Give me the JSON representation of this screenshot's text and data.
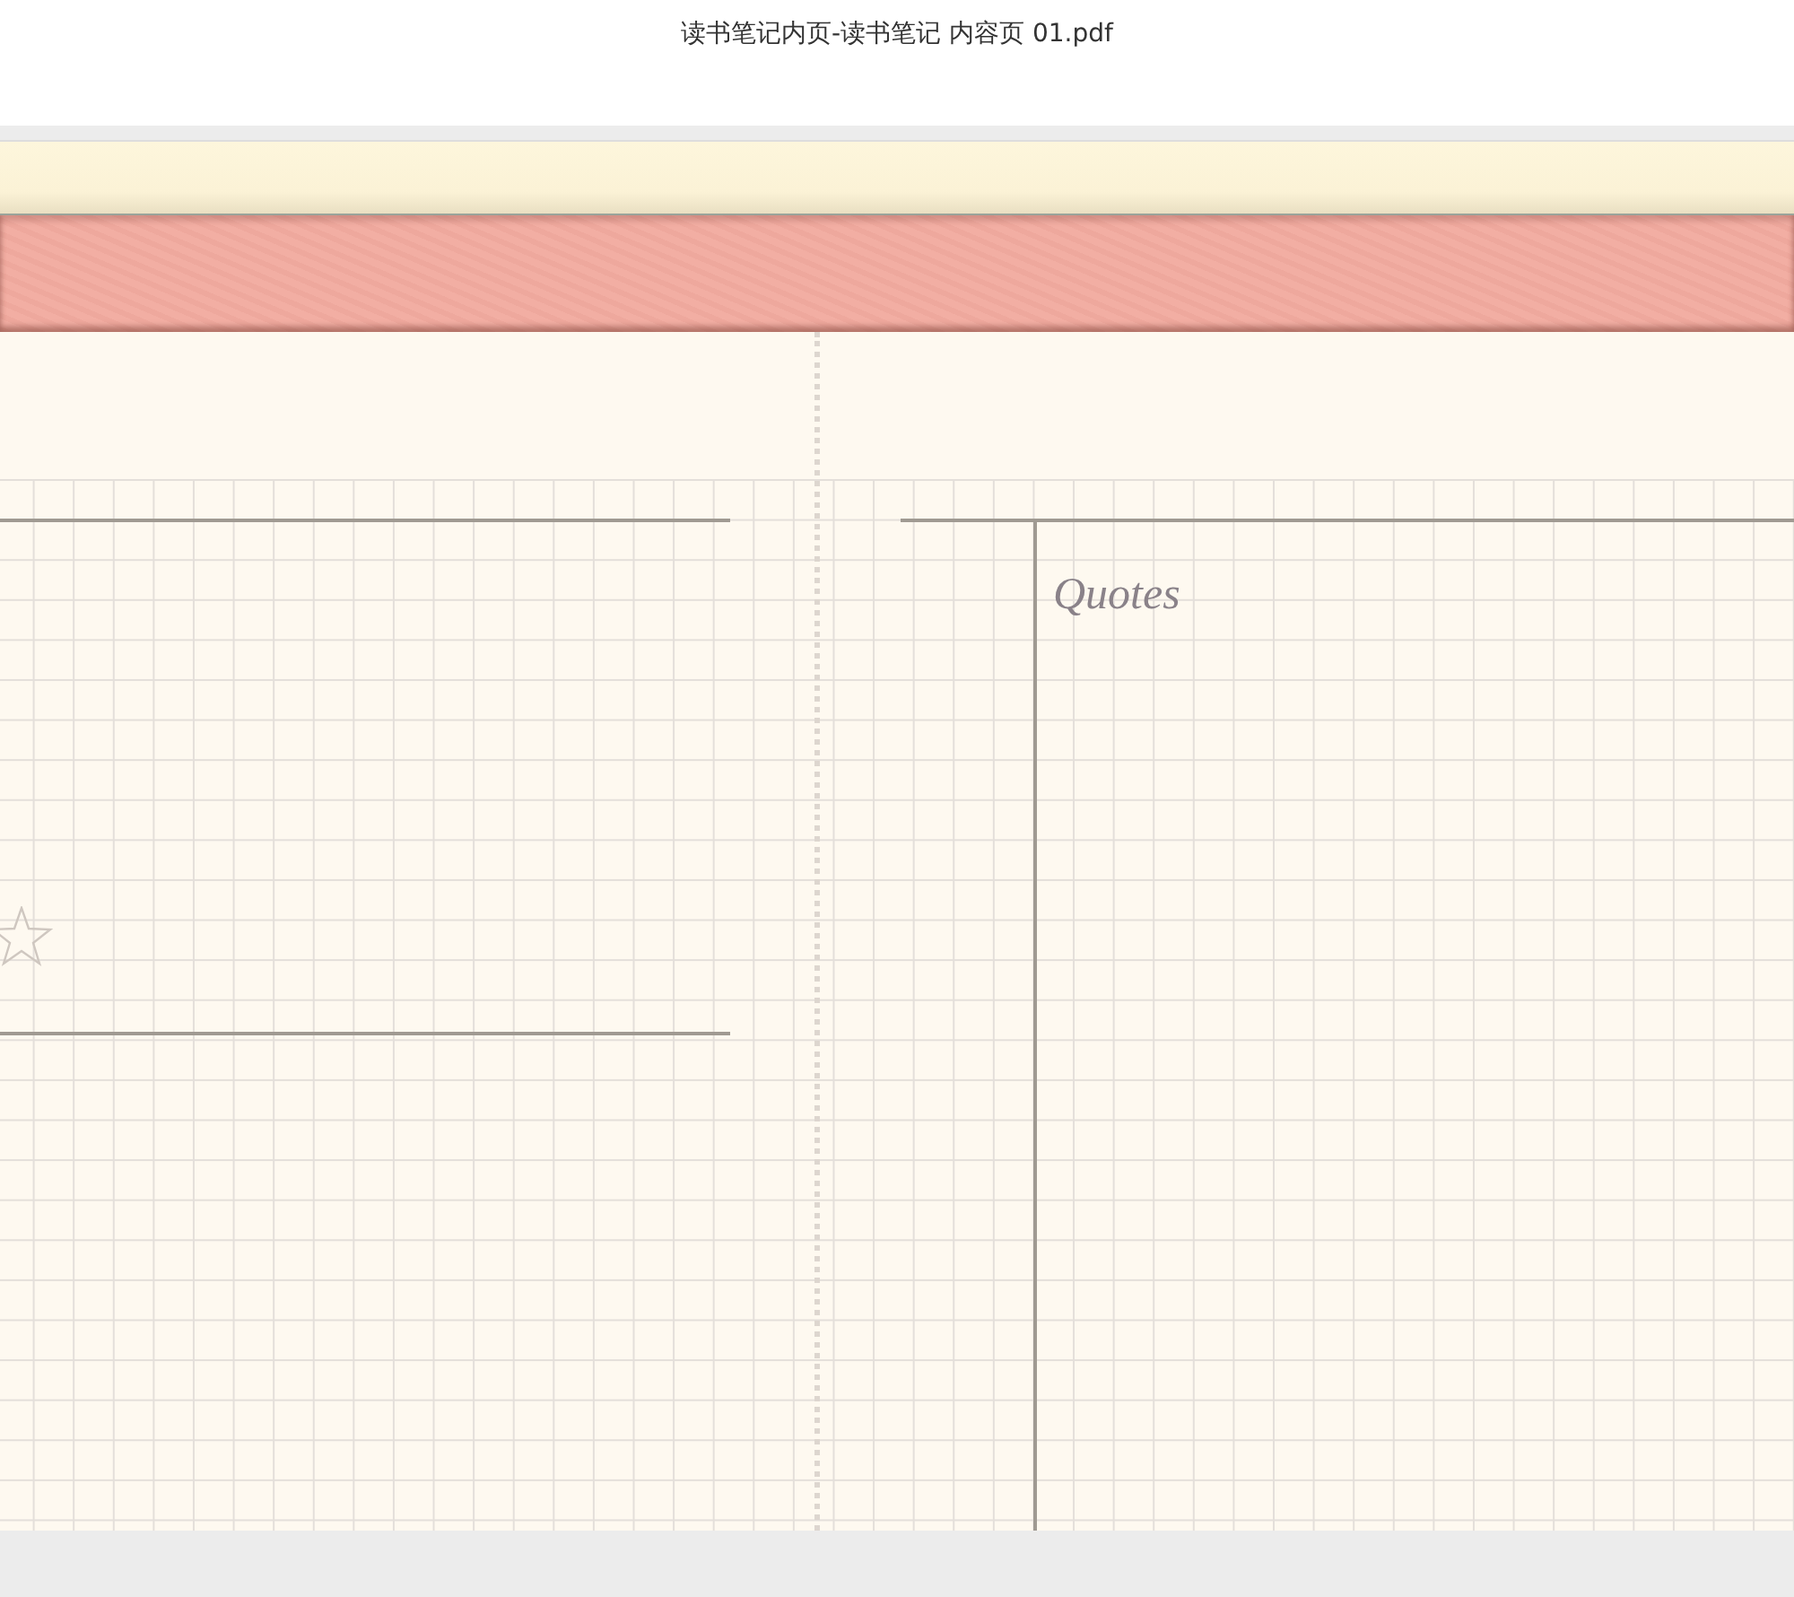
{
  "document": {
    "title": "读书笔记内页-读书笔记 内容页 01.pdf"
  },
  "page": {
    "quotes_panel": {
      "heading": "Quotes"
    }
  }
}
